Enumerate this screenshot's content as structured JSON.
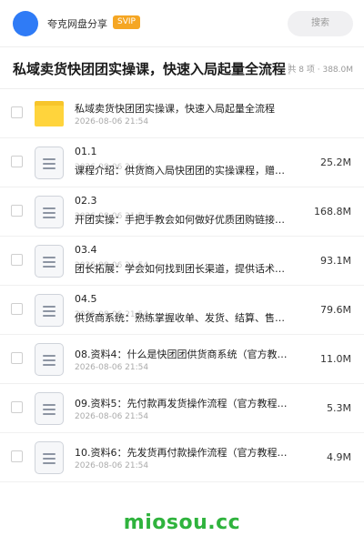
{
  "header": {
    "username": "夸克网盘分享",
    "badge": "SVIP",
    "search_label": "搜索"
  },
  "folder": {
    "title": "私域卖货快团团实操课，快速入局起量全流程！",
    "meta": "共 8 项 · 388.0M"
  },
  "items": [
    {
      "type": "folder",
      "name": "私域卖货快团团实操课，快速入局起量全流程",
      "date": "2026-08-06 21:54",
      "size": ""
    },
    {
      "type": "file",
      "name": "01.1",
      "desc": "课程介绍：供货商入局快团团的实操课程，赠…",
      "date": "2026-08-06 21:54",
      "size": "25.2M"
    },
    {
      "type": "file",
      "name": "02.3",
      "desc": "开团实操：手把手教会如何做好优质团购链接…",
      "date": "2026-08-06 21:54",
      "size": "168.8M"
    },
    {
      "type": "file",
      "name": "03.4",
      "desc": "团长拓展：学会如何找到团长渠道，提供话术…",
      "date": "2026-08-06 21:54",
      "size": "93.1M"
    },
    {
      "type": "file",
      "name": "04.5",
      "desc": "供货商系统：熟练掌握收单、发货、结算、售…",
      "date": "2026-08-06 21:54",
      "size": "79.6M"
    },
    {
      "type": "file",
      "name": "08.资料4：什么是快团团供货商系统（官方教程）.…",
      "date": "2026-08-06 21:54",
      "size": "11.0M"
    },
    {
      "type": "file",
      "name": "09.资料5：先付款再发货操作流程（官方教程）.m…",
      "date": "2026-08-06 21:54",
      "size": "5.3M"
    },
    {
      "type": "file",
      "name": "10.资料6：先发货再付款操作流程（官方教程）.m…",
      "date": "2026-08-06 21:54",
      "size": "4.9M"
    }
  ],
  "watermark": "miosou.cc",
  "colors": {
    "accent": "#2f7bf6",
    "svip": "#f5a623",
    "folder": "#ffd43c",
    "watermark": "#2fb33d"
  }
}
